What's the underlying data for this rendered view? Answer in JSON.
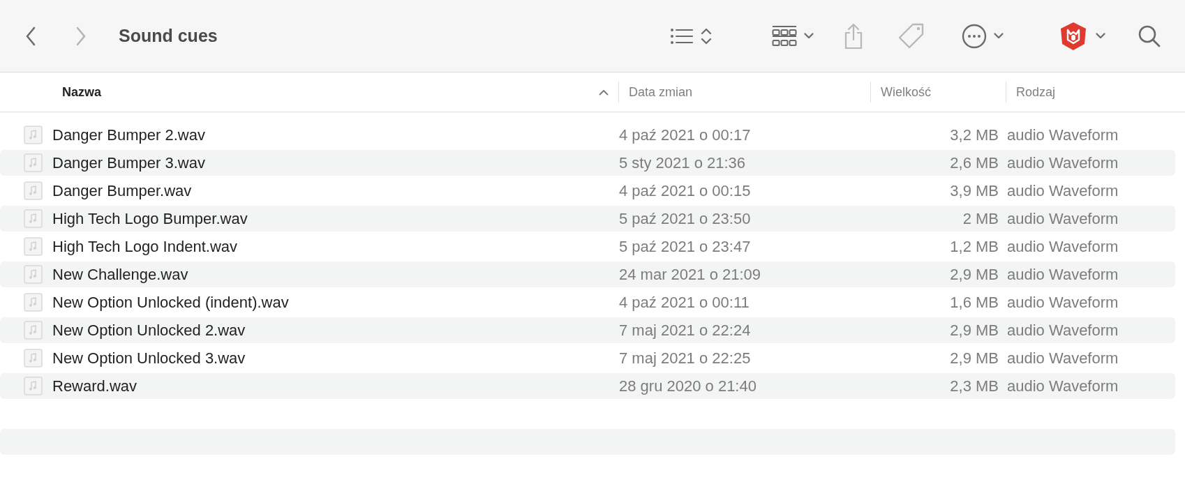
{
  "window": {
    "title": "Sound cues"
  },
  "navigation": [
    {
      "kind": "back",
      "disabled": false
    },
    {
      "kind": "forward",
      "disabled": true
    }
  ],
  "toolbar": [
    {
      "kind": "list-view",
      "disabled": false,
      "menu": false
    },
    {
      "kind": "group",
      "disabled": false,
      "menu": true
    },
    {
      "kind": "share",
      "disabled": true,
      "menu": false
    },
    {
      "kind": "tag",
      "disabled": true,
      "menu": false
    },
    {
      "kind": "more",
      "disabled": false,
      "menu": true
    },
    {
      "kind": "app",
      "disabled": false,
      "menu": true
    },
    {
      "kind": "search",
      "disabled": false,
      "menu": false
    }
  ],
  "table": {
    "columns": [
      {
        "label": "Nazwa",
        "sorted": true
      },
      {
        "label": "Data zmian",
        "sorted": false
      },
      {
        "label": "Wielkość",
        "sorted": false
      },
      {
        "label": "Rodzaj",
        "sorted": false
      }
    ],
    "rows": [
      {
        "name": "Danger Bumper 2.wav",
        "date": "4 paź 2021 o 00:17",
        "size": "3,2 MB",
        "kind": "audio Waveform"
      },
      {
        "name": "Danger Bumper 3.wav",
        "date": "5 sty 2021 o 21:36",
        "size": "2,6 MB",
        "kind": "audio Waveform"
      },
      {
        "name": "Danger Bumper.wav",
        "date": "4 paź 2021 o 00:15",
        "size": "3,9 MB",
        "kind": "audio Waveform"
      },
      {
        "name": "High Tech Logo Bumper.wav",
        "date": "5 paź 2021 o 23:50",
        "size": "2 MB",
        "kind": "audio Waveform"
      },
      {
        "name": "High Tech Logo Indent.wav",
        "date": "5 paź 2021 o 23:47",
        "size": "1,2 MB",
        "kind": "audio Waveform"
      },
      {
        "name": "New Challenge.wav",
        "date": "24 mar 2021 o 21:09",
        "size": "2,9 MB",
        "kind": "audio Waveform"
      },
      {
        "name": "New Option Unlocked (indent).wav",
        "date": "4 paź 2021 o 00:11",
        "size": "1,6 MB",
        "kind": "audio Waveform"
      },
      {
        "name": "New Option Unlocked 2.wav",
        "date": "7 maj 2021 o 22:24",
        "size": "2,9 MB",
        "kind": "audio Waveform"
      },
      {
        "name": "New Option Unlocked 3.wav",
        "date": "7 maj 2021 o 22:25",
        "size": "2,9 MB",
        "kind": "audio Waveform"
      },
      {
        "name": "Reward.wav",
        "date": "28 gru 2020 o 21:40",
        "size": "2,3 MB",
        "kind": "audio Waveform"
      }
    ]
  }
}
